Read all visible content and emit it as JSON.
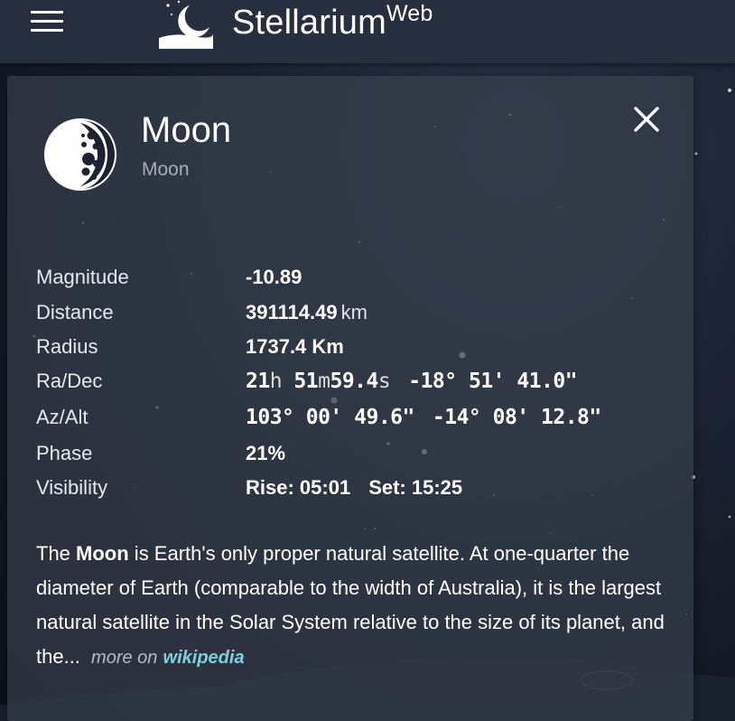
{
  "app": {
    "brand": "Stellarium",
    "brand_suffix": "Web"
  },
  "object": {
    "name": "Moon",
    "type": "Moon"
  },
  "info": {
    "magnitude": {
      "label": "Magnitude",
      "value": "-10.89"
    },
    "distance": {
      "label": "Distance",
      "value": "391114.49",
      "unit": "km"
    },
    "radius": {
      "label": "Radius",
      "value": "1737.4 Km"
    },
    "radec": {
      "label": "Ra/Dec",
      "ra_h": "21",
      "ra_h_unit": "h",
      "ra_m": "51",
      "ra_m_unit": "m",
      "ra_s": "59.4",
      "ra_s_unit": "s",
      "dec": "-18° 51' 41.0\""
    },
    "azalt": {
      "label": "Az/Alt",
      "az": "103° 00' 49.6\"",
      "alt": "-14° 08' 12.8\""
    },
    "phase": {
      "label": "Phase",
      "value": "21%"
    },
    "visibility": {
      "label": "Visibility",
      "rise": "Rise: 05:01",
      "set": "Set: 15:25"
    }
  },
  "description": {
    "prefix": "The ",
    "bold": "Moon",
    "text": " is Earth's only proper natural satellite. At one-quarter the diameter of Earth (comparable to the width of Australia), it is the largest natural satellite in the Solar System relative to the size of its planet, and the...",
    "more_on": "more on",
    "link": "wikipedia"
  },
  "colors": {
    "accent_link": "#7fd0dc",
    "topbar": "#272f3e",
    "panel": "#383f4c"
  }
}
